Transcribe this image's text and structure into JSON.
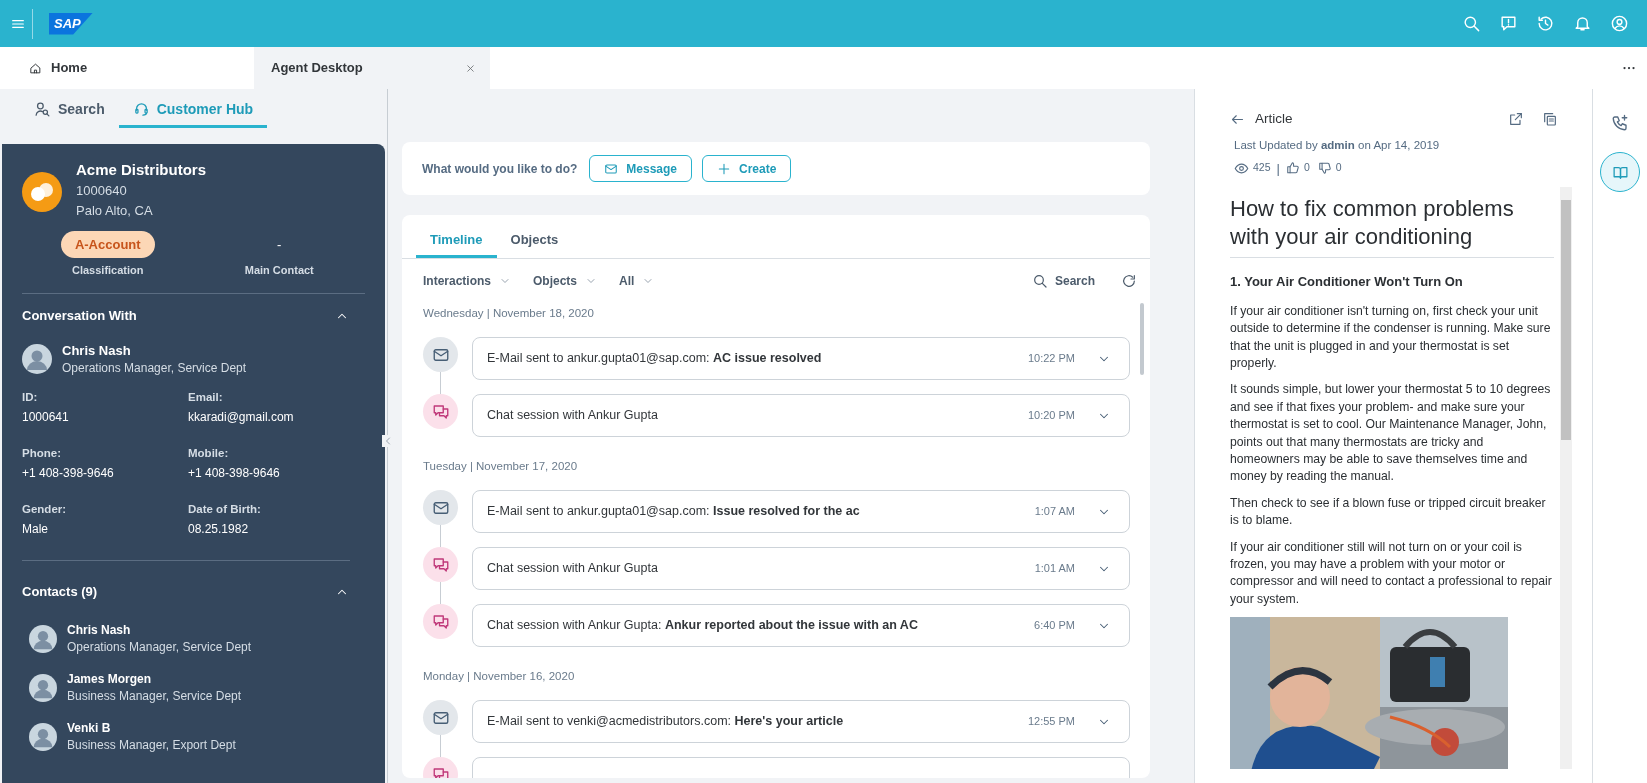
{
  "shell_bar": {
    "logo": "SAP"
  },
  "tabs": [
    {
      "label": "Home",
      "selected": false,
      "closable": false
    },
    {
      "label": "Agent Desktop",
      "selected": true,
      "closable": true
    }
  ],
  "side_tabs": [
    {
      "label": "Search",
      "kind": "search",
      "selected": false
    },
    {
      "label": "Customer Hub",
      "kind": "hub",
      "selected": true
    }
  ],
  "account": {
    "name": "Acme Distributors",
    "id": "1000640",
    "location": "Palo Alto, CA",
    "classification": "A-Account",
    "classification_label": "Classification",
    "main_contact": "-",
    "main_contact_label": "Main Contact"
  },
  "conversation": {
    "title": "Conversation With",
    "expanded": true,
    "contact": {
      "name": "Chris Nash",
      "role": "Operations Manager, Service Dept"
    },
    "fields": [
      {
        "label": "ID:",
        "value": "1000641"
      },
      {
        "label": "Email:",
        "value": "kkaradi@gmail.com"
      },
      {
        "label": "Phone:",
        "value": "+1 408-398-9646"
      },
      {
        "label": "Mobile:",
        "value": "+1 408-398-9646"
      },
      {
        "label": "Gender:",
        "value": "Male"
      },
      {
        "label": "Date of Birth:",
        "value": "08.25.1982"
      }
    ]
  },
  "contacts": {
    "title": "Contacts (9)",
    "expanded": true,
    "items": [
      {
        "name": "Chris Nash",
        "role": "Operations Manager, Service Dept"
      },
      {
        "name": "James Morgen",
        "role": "Business Manager, Service Dept"
      },
      {
        "name": "Venki B",
        "role": "Business Manager, Export Dept"
      }
    ]
  },
  "actions": {
    "prompt": "What would you like to do?",
    "buttons": [
      {
        "label": "Message",
        "kind": "message"
      },
      {
        "label": "Create",
        "kind": "create"
      }
    ]
  },
  "timeline": {
    "tabs": [
      {
        "label": "Timeline",
        "selected": true
      },
      {
        "label": "Objects",
        "selected": false
      }
    ],
    "filters": [
      "Interactions",
      "Objects",
      "All"
    ],
    "search": "Search",
    "groups": [
      {
        "date": "Wednesday | November 18, 2020",
        "entries": [
          {
            "kind": "email",
            "text": "E-Mail sent to ankur.gupta01@sap.com: **AC issue resolved**",
            "time": "10:22 PM"
          },
          {
            "kind": "chat",
            "text": "Chat session with Ankur Gupta",
            "time": "10:20 PM"
          }
        ]
      },
      {
        "date": "Tuesday | November 17, 2020",
        "entries": [
          {
            "kind": "email",
            "text": "E-Mail sent to ankur.gupta01@sap.com: **Issue resolved for the ac**",
            "time": "1:07 AM"
          },
          {
            "kind": "chat",
            "text": "Chat session with Ankur Gupta",
            "time": "1:01 AM"
          },
          {
            "kind": "chat",
            "text": "Chat session with Ankur Gupta: **Ankur reported about the issue with an AC**",
            "time": "6:40 PM"
          }
        ]
      },
      {
        "date": "Monday | November 16, 2020",
        "entries": [
          {
            "kind": "email",
            "text": "E-Mail sent to venki@acmedistributors.com: **Here's your article**",
            "time": "12:55 PM"
          },
          {
            "kind": "chat"
          }
        ]
      }
    ]
  },
  "article": {
    "title": "Article",
    "updated": "Last Updated by **admin** on Apr 14, 2019",
    "views": "425",
    "separator": "|",
    "likes": "0",
    "dislikes": "0",
    "heading": "How to fix common problems with your air conditioning",
    "subheading": "1. Your Air Conditioner Won't Turn On",
    "paragraphs": [
      "If your air conditioner isn't turning on, first check your unit outside to determine if the condenser is running. Make sure that the unit is plugged in and your thermostat is set properly.",
      "It sounds simple, but lower your thermostat 5 to 10 degrees and see if that fixes your problem- and make sure your thermostat is set to cool. Our Maintenance Manager, John, points out that many thermostats are tricky and homeowners may be able to save themselves time and money by reading the manual.",
      "Then check to see if a blown fuse or tripped circuit breaker is to blame.",
      "If your air conditioner still will not turn on or your coil is frozen, you may have a problem with your motor or compressor and will need to contact a professional to repair your system."
    ]
  }
}
